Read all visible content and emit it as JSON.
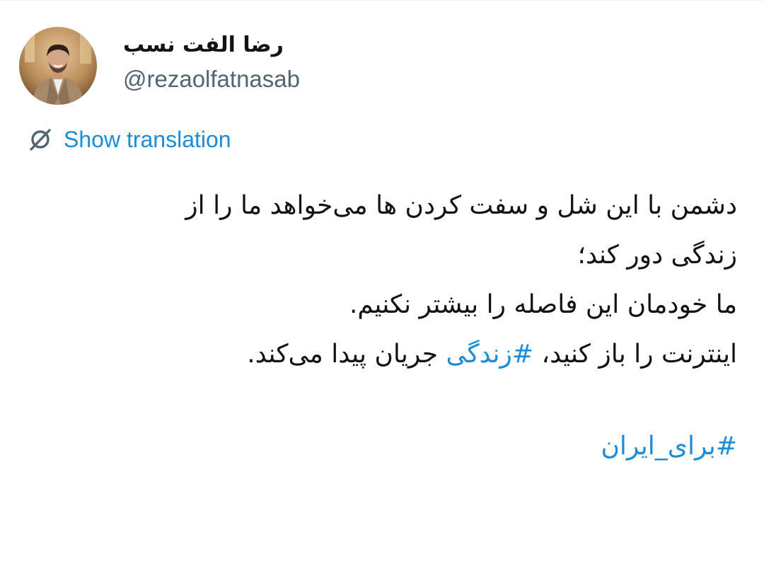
{
  "author": {
    "display_name": "رضا الفت نسب",
    "handle": "@rezaolfatnasab"
  },
  "translate": {
    "icon": "globe-slash-icon",
    "label": "Show translation"
  },
  "tweet": {
    "line1": "دشمن با این شل و سفت کردن ها می‌خواهد ما را از",
    "line2": "زندگی دور کند؛",
    "line3": "ما خودمان این فاصله را بیشتر نکنیم.",
    "line4_before": "اینترنت را باز کنید، ",
    "line4_hashtag": "#زندگی",
    "line4_after": " جریان پیدا می‌کند.",
    "hashtag_final": "#برای_ایران"
  },
  "colors": {
    "link": "#1a8cd8",
    "text": "#0f1419",
    "secondary": "#536471"
  }
}
